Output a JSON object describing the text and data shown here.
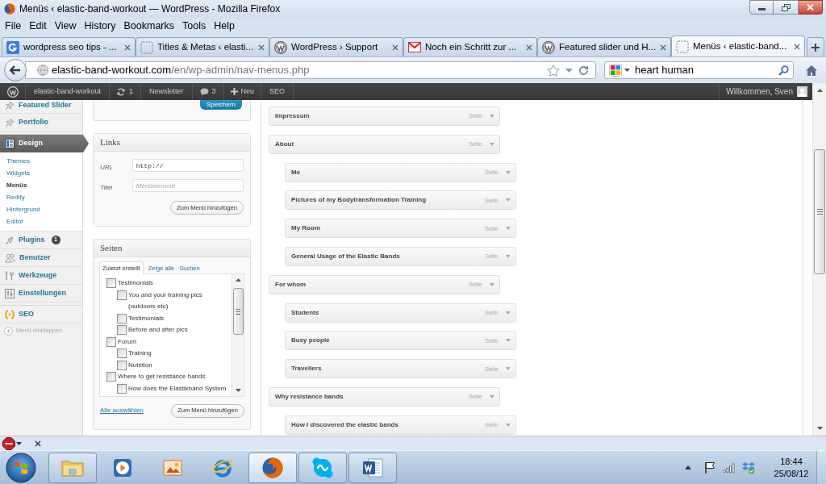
{
  "window": {
    "title": "Menüs ‹ elastic-band-workout — WordPress - Mozilla Firefox"
  },
  "menu_bar": [
    "File",
    "Edit",
    "View",
    "History",
    "Bookmarks",
    "Tools",
    "Help"
  ],
  "tabs": [
    {
      "label": "wordpress seo tips - ...",
      "kind": "google",
      "selected": false
    },
    {
      "label": "Titles & Metas ‹ elasti...",
      "kind": "blank",
      "selected": false
    },
    {
      "label": "WordPress › Support",
      "kind": "wordpress",
      "selected": false
    },
    {
      "label": "Noch ein Schritt zur ...",
      "kind": "gmail",
      "selected": false
    },
    {
      "label": "Featured slider und H...",
      "kind": "wordpress",
      "selected": false
    },
    {
      "label": "Menüs ‹ elastic-band...",
      "kind": "blank",
      "selected": true
    }
  ],
  "address_bar": {
    "host": "elastic-band-workout.com",
    "path": "/en/wp-admin/nav-menus.php"
  },
  "search": {
    "value": "heart human"
  },
  "admin_bar": {
    "items": [
      {
        "kind": "logo"
      },
      {
        "kind": "link",
        "label": "elastic-band-workout"
      },
      {
        "kind": "updates",
        "label": "1"
      },
      {
        "kind": "link",
        "label": "Newsletter"
      },
      {
        "kind": "comments",
        "label": "3"
      },
      {
        "kind": "new",
        "label": "Neu"
      },
      {
        "kind": "link",
        "label": "SEO"
      }
    ],
    "account": "Willkommen, Sven"
  },
  "sidebar": {
    "items": [
      {
        "kind": "pin",
        "label": "Featured Slider",
        "selected": false
      },
      {
        "kind": "pin",
        "label": "Portfolio",
        "selected": false
      },
      {
        "kind": "separator"
      },
      {
        "kind": "appearance",
        "label": "Design",
        "selected": true,
        "children": [
          {
            "label": "Themes",
            "selected": false
          },
          {
            "label": "Widgets",
            "selected": false
          },
          {
            "label": "Menüs",
            "selected": true
          },
          {
            "label": "Redify",
            "selected": false
          },
          {
            "label": "Hintergrund",
            "selected": false
          },
          {
            "label": "Editor",
            "selected": false
          }
        ]
      },
      {
        "kind": "plugins",
        "label": "Plugins",
        "badge": "1",
        "selected": false
      },
      {
        "kind": "users",
        "label": "Benutzer",
        "selected": false
      },
      {
        "kind": "tools",
        "label": "Werkzeuge",
        "selected": false
      },
      {
        "kind": "settings",
        "label": "Einstellungen",
        "selected": false
      },
      {
        "kind": "separator"
      },
      {
        "kind": "seo",
        "label": "SEO",
        "selected": false
      }
    ],
    "collapse": "Menü einklappen"
  },
  "save_box": {
    "button": "Speichern"
  },
  "links_box": {
    "title": "Links",
    "url_label": "URL",
    "url_value": "http://",
    "title_label": "Titel",
    "title_placeholder": "Menüelement",
    "button": "Zum Menü hinzufügen"
  },
  "pages_box": {
    "title": "Seiten",
    "tabs": [
      {
        "label": "Zuletzt erstellt",
        "selected": true
      },
      {
        "label": "Zeige alle",
        "selected": false
      },
      {
        "label": "Suchen",
        "selected": false
      }
    ],
    "pages": [
      {
        "label": "Testimonials",
        "checked": false,
        "children": [
          {
            "label": "You and your training pics (outdoors etc)",
            "checked": false
          },
          {
            "label": "Testimonials",
            "checked": false
          },
          {
            "label": "Before and after pics",
            "checked": false
          }
        ]
      },
      {
        "label": "Forum",
        "checked": false,
        "children": [
          {
            "label": "Training",
            "checked": false
          },
          {
            "label": "Nutrition",
            "checked": false
          }
        ]
      },
      {
        "label": "Where to get resistance bands",
        "checked": false,
        "children": [
          {
            "label": "How does the Elastikband System",
            "checked": false
          }
        ]
      }
    ],
    "select_all": "Alle auswählen",
    "button": "Zum Menü hinzufügen"
  },
  "menu_items": [
    {
      "label": "Impressum",
      "type": "Seite"
    },
    {
      "label": "About",
      "type": "Seite",
      "children": [
        {
          "label": "Me",
          "type": "Seite"
        },
        {
          "label": "Pictures of my Bodytransformation Training",
          "type": "Seite"
        },
        {
          "label": "My Room",
          "type": "Seite"
        },
        {
          "label": "General Usage of the Elastic Bands",
          "type": "Seite"
        }
      ]
    },
    {
      "label": "For whom",
      "type": "Seite",
      "children": [
        {
          "label": "Students",
          "type": "Seite"
        },
        {
          "label": "Busy people",
          "type": "Seite"
        },
        {
          "label": "Travellers",
          "type": "Seite"
        }
      ]
    },
    {
      "label": "Why resistance bands",
      "type": "Seite",
      "children": [
        {
          "label": "How I discovered the elastic bands",
          "type": "Seite"
        }
      ]
    }
  ],
  "taskbar": {
    "apps": [
      {
        "kind": "explorer",
        "running": true,
        "selected": false
      },
      {
        "kind": "mediaplayer",
        "running": false,
        "selected": false
      },
      {
        "kind": "paint",
        "running": false,
        "selected": false
      },
      {
        "kind": "ie",
        "running": false,
        "selected": false
      },
      {
        "kind": "firefox",
        "running": true,
        "selected": true
      },
      {
        "kind": "skype",
        "running": true,
        "selected": false
      },
      {
        "kind": "word",
        "running": true,
        "selected": false
      }
    ],
    "time": "18:44",
    "date": "25/08/12"
  }
}
